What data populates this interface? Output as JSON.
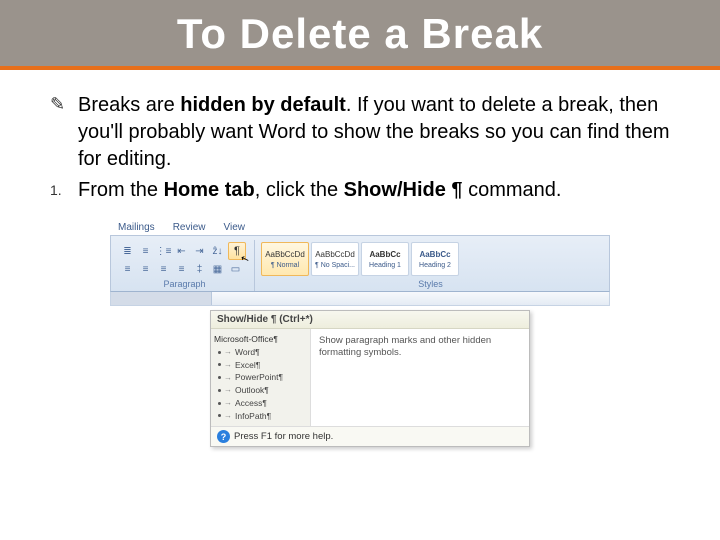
{
  "title": "To Delete a Break",
  "body": {
    "bullet_pre": "Breaks are ",
    "bullet_bold1": "hidden by default",
    "bullet_post": ". If you want to delete a break, then you'll probably want Word to show the breaks so you can find them for editing.",
    "num_pre": "From the ",
    "num_bold1": "Home tab",
    "num_mid": ", click the ",
    "num_bold2": "Show/Hide ¶",
    "num_post": " command."
  },
  "ribbon": {
    "tabs": [
      "Mailings",
      "Review",
      "View"
    ],
    "paragraph_group": "Paragraph",
    "styles_group": "Styles",
    "pilcrow": "¶",
    "styles": [
      {
        "sample": "AaBbCcDd",
        "name": "¶ Normal"
      },
      {
        "sample": "AaBbCcDd",
        "name": "¶ No Spaci..."
      },
      {
        "sample": "AaBbCc",
        "name": "Heading 1"
      },
      {
        "sample": "AaBbCc",
        "name": "Heading 2"
      }
    ]
  },
  "tooltip": {
    "title": "Show/Hide ¶ (Ctrl+*)",
    "left_head": "Microsoft-Office¶",
    "left_items": [
      "Word¶",
      "Excel¶",
      "PowerPoint¶",
      "Outlook¶",
      "Access¶",
      "InfoPath¶"
    ],
    "desc": "Show paragraph marks and other hidden formatting symbols.",
    "footer": "Press F1 for more help."
  }
}
